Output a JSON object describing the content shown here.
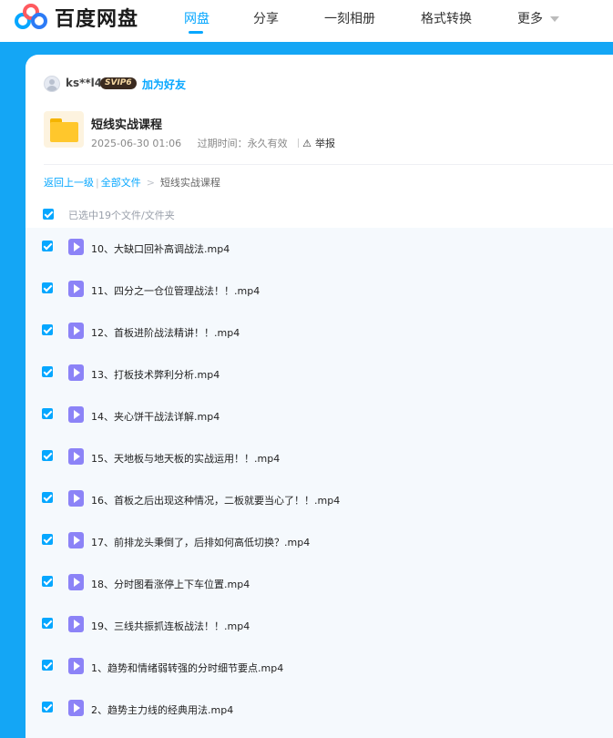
{
  "app": {
    "logo_text": "百度网盘"
  },
  "nav": {
    "items": [
      {
        "label": "网盘",
        "active": true
      },
      {
        "label": "分享",
        "active": false
      },
      {
        "label": "一刻相册",
        "active": false
      },
      {
        "label": "格式转换",
        "active": false
      },
      {
        "label": "更多",
        "active": false
      }
    ]
  },
  "share": {
    "username": "ks**l4",
    "vip_badge": "SVIP6",
    "add_friend": "加为好友",
    "folder_name": "短线实战课程",
    "date": "2025-06-30 01:06",
    "expire_label": "过期时间：",
    "expire_value": "永久有效",
    "report": "举报"
  },
  "breadcrumb": {
    "back": "返回上一级",
    "all_files": "全部文件",
    "current": "短线实战课程"
  },
  "selection": {
    "text": "已选中19个文件/文件夹"
  },
  "files": [
    {
      "name": "10、大缺口回补高调战法.mp4"
    },
    {
      "name": "11、四分之一仓位管理战法！！.mp4"
    },
    {
      "name": "12、首板进阶战法精讲！！.mp4"
    },
    {
      "name": "13、打板技术弊利分析.mp4"
    },
    {
      "name": "14、夹心饼干战法详解.mp4"
    },
    {
      "name": "15、天地板与地天板的实战运用！！.mp4"
    },
    {
      "name": "16、首板之后出现这种情况，二板就要当心了！！.mp4"
    },
    {
      "name": "17、前排龙头秉倒了，后排如何高低切换？.mp4"
    },
    {
      "name": "18、分时图看涨停上下车位置.mp4"
    },
    {
      "name": "19、三线共振抓连板战法！！.mp4"
    },
    {
      "name": "1、趋势和情绪弱转强的分时细节要点.mp4"
    },
    {
      "name": "2、趋势主力线的经典用法.mp4"
    }
  ],
  "colors": {
    "brand_blue": "#06a7ff",
    "band_blue": "#14a6f5",
    "video_icon": "#8c83f7"
  }
}
